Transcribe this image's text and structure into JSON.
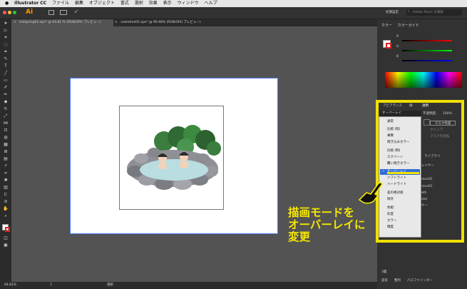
{
  "menubar": {
    "app": "Illustrator CC",
    "items": [
      "ファイル",
      "編集",
      "オブジェクト",
      "書式",
      "選択",
      "効果",
      "表示",
      "ウィンドウ",
      "ヘルプ"
    ]
  },
  "appbar": {
    "logo": "Ai",
    "workspace": "初期設定",
    "search_placeholder": "Adobe Stock を検索"
  },
  "tabs": [
    {
      "label": "hotspring02.eps* @ 64.81 % (RGB/GPU プレビュー)",
      "close": "×"
    },
    {
      "label": "valentine01.eps* @ 90.48% (RGB/GPU プレビュー)",
      "close": "×"
    }
  ],
  "status": {
    "zoom": "64.81%",
    "page": "1",
    "mode": "選択"
  },
  "color_panel": {
    "tab1": "カラー",
    "tab2": "カラーガイド",
    "r": "R",
    "g": "G",
    "b": "B"
  },
  "transparency_panel": {
    "tab_appearance": "アピアランス",
    "tab_layers": "線",
    "tab_transparency": "透明",
    "blend_mode": "オーバーレイ",
    "opacity_label": "不透明度：",
    "opacity_value": "100%",
    "make_mask": "マスク作成",
    "clip": "クリップ",
    "invert_mask": "マスクを反転"
  },
  "layers_panel": {
    "library": "ライブラリ",
    "rows": [
      "レイヤー",
      "race02",
      "race01",
      "ath",
      "olor",
      "ヤー"
    ],
    "layer_count": "3層"
  },
  "blend_menu": {
    "items": [
      "通常",
      "比較 (暗)",
      "乗算",
      "焼き込みカラー",
      "比較 (明)",
      "スクリーン",
      "覆い焼きカラー",
      "オーバーレイ",
      "ソフトライト",
      "ハードライト",
      "差の絶対値",
      "除外",
      "色相",
      "彩度",
      "カラー",
      "輝度"
    ],
    "selected": "オーバーレイ",
    "check": "✓"
  },
  "bottom_tabs": {
    "tab1": "変形",
    "tab2": "整列",
    "tab3": "パスファインダー"
  },
  "caption": {
    "line1": "描画モードを",
    "line2": "オーバーレイに",
    "line3": "変更"
  },
  "colors": {
    "highlight": "#f0e000",
    "caption": "#f5e600",
    "menu_selected": "#2f6fd6"
  }
}
